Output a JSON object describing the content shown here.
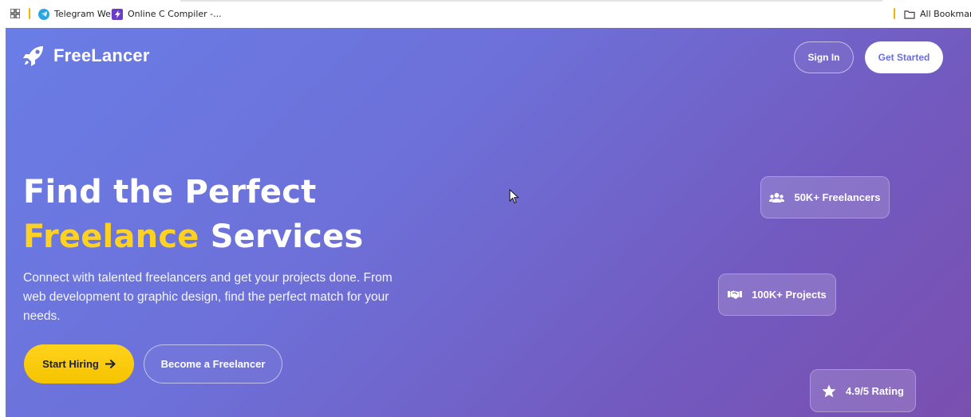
{
  "bookmarks_bar": {
    "items": [
      {
        "label": "Telegram Web",
        "icon": "telegram-icon"
      },
      {
        "label": "Online C Compiler -...",
        "icon": "compiler-icon"
      }
    ],
    "all_bookmarks_label": "All Bookmarks"
  },
  "nav": {
    "brand": "FreeLancer",
    "signin_label": "Sign In",
    "get_started_label": "Get Started"
  },
  "hero": {
    "headline_line1": "Find the Perfect",
    "headline_highlight": "Freelance",
    "headline_rest": "Services",
    "subtext": "Connect with talented freelancers and get your projects done. From web development to graphic design, find the perfect match for your needs.",
    "start_hiring_label": "Start Hiring",
    "become_freelancer_label": "Become a Freelancer"
  },
  "stats": [
    {
      "label": "50K+ Freelancers",
      "icon": "users-icon"
    },
    {
      "label": "100K+ Projects",
      "icon": "handshake-icon"
    },
    {
      "label": "4.9/5 Rating",
      "icon": "star-icon"
    }
  ],
  "colors": {
    "accent_yellow": "#ffd21f",
    "gradient_start": "#6a7de6",
    "gradient_end": "#7a4fb0",
    "get_started_text": "#6a6ee0"
  }
}
